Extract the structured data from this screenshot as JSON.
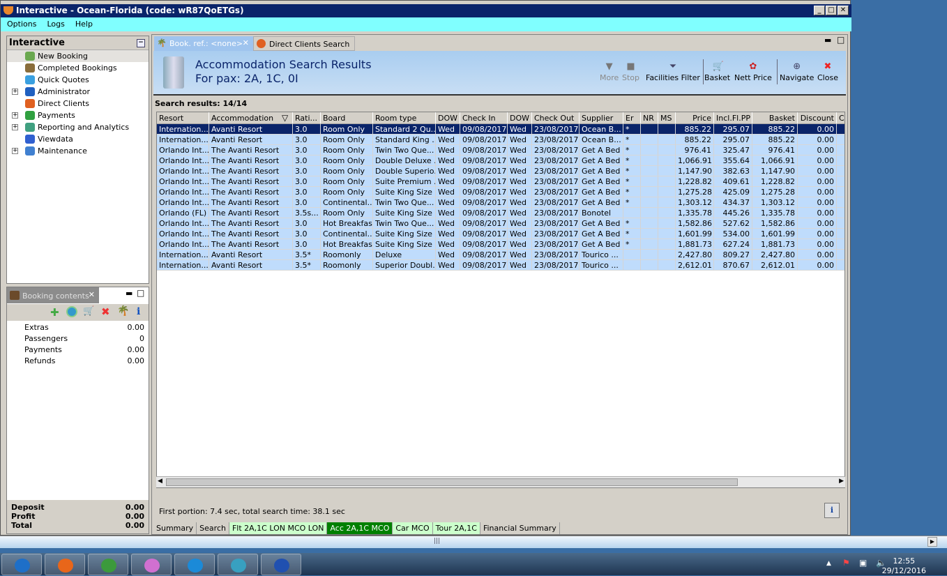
{
  "window": {
    "title": "Interactive - Ocean-Florida (code: wR87QoETGs)"
  },
  "menu": [
    "Options",
    "Logs",
    "Help"
  ],
  "nav": {
    "title": "Interactive",
    "items": [
      {
        "label": "New Booking",
        "expand": false,
        "color": "#6aa84f"
      },
      {
        "label": "Completed Bookings",
        "expand": false,
        "color": "#8a6d3b"
      },
      {
        "label": "Quick Quotes",
        "expand": false,
        "color": "#3aa0e0"
      },
      {
        "label": "Administrator",
        "expand": true,
        "color": "#2060c0"
      },
      {
        "label": "Direct Clients",
        "expand": false,
        "color": "#e06020"
      },
      {
        "label": "Payments",
        "expand": true,
        "color": "#30a040"
      },
      {
        "label": "Reporting and Analytics",
        "expand": true,
        "color": "#40a080"
      },
      {
        "label": "Viewdata",
        "expand": false,
        "color": "#3060d0"
      },
      {
        "label": "Maintenance",
        "expand": true,
        "color": "#4080d0"
      }
    ]
  },
  "booking_contents": {
    "tab": "Booking contents",
    "rows": [
      {
        "label": "Extras",
        "value": "0.00"
      },
      {
        "label": "Passengers",
        "value": "0"
      },
      {
        "label": "Payments",
        "value": "0.00"
      },
      {
        "label": "Refunds",
        "value": "0.00"
      }
    ],
    "footer": [
      {
        "label": "Deposit",
        "value": "0.00"
      },
      {
        "label": "Profit",
        "value": "0.00"
      },
      {
        "label": "Total",
        "value": "0.00"
      }
    ]
  },
  "tabs": [
    "Book. ref.: <none>",
    "Direct Clients Search"
  ],
  "header": {
    "title": "Accommodation Search Results",
    "subtitle": "For pax: 2A, 1C, 0I"
  },
  "toolbar": [
    {
      "label": "More",
      "icon": "▼",
      "disabled": true
    },
    {
      "label": "Stop",
      "icon": "■",
      "disabled": true
    },
    {
      "label": "Facilities Filter",
      "icon": "⏷"
    },
    {
      "label": "Basket",
      "icon": "🛒"
    },
    {
      "label": "Nett Price",
      "icon": "✿"
    },
    {
      "label": "Navigate",
      "icon": "⊕"
    },
    {
      "label": "Close",
      "icon": "✖"
    }
  ],
  "results_label": "Search results: 14/14",
  "table": {
    "columns": [
      "Resort",
      "Accommodation",
      "Rati...",
      "Board",
      "Room type",
      "DOW",
      "Check In",
      "DOW",
      "Check Out",
      "Supplier",
      "Er",
      "NR",
      "MS",
      "Price",
      "Incl.Fl.PP",
      "Basket",
      "Discount",
      "C"
    ],
    "rows": [
      [
        "Internation...",
        "Avanti Resort",
        "3.0",
        "Room Only",
        "Standard 2 Qu...",
        "Wed",
        "09/08/2017",
        "Wed",
        "23/08/2017",
        "Ocean B...",
        "*",
        "",
        "",
        "885.22",
        "295.07",
        "885.22",
        "0.00",
        ""
      ],
      [
        "Internation...",
        "Avanti Resort",
        "3.0",
        "Room Only",
        "Standard King ...",
        "Wed",
        "09/08/2017",
        "Wed",
        "23/08/2017",
        "Ocean B...",
        "*",
        "",
        "",
        "885.22",
        "295.07",
        "885.22",
        "0.00",
        ""
      ],
      [
        "Orlando Int...",
        "The Avanti Resort",
        "3.0",
        "Room Only",
        "Twin Two Que...",
        "Wed",
        "09/08/2017",
        "Wed",
        "23/08/2017",
        "Get A Bed",
        "*",
        "",
        "",
        "976.41",
        "325.47",
        "976.41",
        "0.00",
        ""
      ],
      [
        "Orlando Int...",
        "The Avanti Resort",
        "3.0",
        "Room Only",
        "Double Deluxe ...",
        "Wed",
        "09/08/2017",
        "Wed",
        "23/08/2017",
        "Get A Bed",
        "*",
        "",
        "",
        "1,066.91",
        "355.64",
        "1,066.91",
        "0.00",
        ""
      ],
      [
        "Orlando Int...",
        "The Avanti Resort",
        "3.0",
        "Room Only",
        "Double Superio...",
        "Wed",
        "09/08/2017",
        "Wed",
        "23/08/2017",
        "Get A Bed",
        "*",
        "",
        "",
        "1,147.90",
        "382.63",
        "1,147.90",
        "0.00",
        ""
      ],
      [
        "Orlando Int...",
        "The Avanti Resort",
        "3.0",
        "Room Only",
        "Suite Premium ...",
        "Wed",
        "09/08/2017",
        "Wed",
        "23/08/2017",
        "Get A Bed",
        "*",
        "",
        "",
        "1,228.82",
        "409.61",
        "1,228.82",
        "0.00",
        ""
      ],
      [
        "Orlando Int...",
        "The Avanti Resort",
        "3.0",
        "Room Only",
        "Suite King Size ...",
        "Wed",
        "09/08/2017",
        "Wed",
        "23/08/2017",
        "Get A Bed",
        "*",
        "",
        "",
        "1,275.28",
        "425.09",
        "1,275.28",
        "0.00",
        ""
      ],
      [
        "Orlando Int...",
        "The Avanti Resort",
        "3.0",
        "Continental...",
        "Twin Two Que...",
        "Wed",
        "09/08/2017",
        "Wed",
        "23/08/2017",
        "Get A Bed",
        "*",
        "",
        "",
        "1,303.12",
        "434.37",
        "1,303.12",
        "0.00",
        ""
      ],
      [
        "Orlando (FL)",
        "The Avanti Resort",
        "3.5s...",
        "Room Only",
        "Suite King Size ...",
        "Wed",
        "09/08/2017",
        "Wed",
        "23/08/2017",
        "Bonotel",
        "",
        "",
        "",
        "1,335.78",
        "445.26",
        "1,335.78",
        "0.00",
        ""
      ],
      [
        "Orlando Int...",
        "The Avanti Resort",
        "3.0",
        "Hot Breakfast",
        "Twin Two Que...",
        "Wed",
        "09/08/2017",
        "Wed",
        "23/08/2017",
        "Get A Bed",
        "*",
        "",
        "",
        "1,582.86",
        "527.62",
        "1,582.86",
        "0.00",
        ""
      ],
      [
        "Orlando Int...",
        "The Avanti Resort",
        "3.0",
        "Continental...",
        "Suite King Size ...",
        "Wed",
        "09/08/2017",
        "Wed",
        "23/08/2017",
        "Get A Bed",
        "*",
        "",
        "",
        "1,601.99",
        "534.00",
        "1,601.99",
        "0.00",
        ""
      ],
      [
        "Orlando Int...",
        "The Avanti Resort",
        "3.0",
        "Hot Breakfast",
        "Suite King Size ...",
        "Wed",
        "09/08/2017",
        "Wed",
        "23/08/2017",
        "Get A Bed",
        "*",
        "",
        "",
        "1,881.73",
        "627.24",
        "1,881.73",
        "0.00",
        ""
      ],
      [
        "Internation...",
        "Avanti Resort",
        "3.5*",
        "Roomonly",
        "Deluxe",
        "Wed",
        "09/08/2017",
        "Wed",
        "23/08/2017",
        "Tourico ...",
        "",
        "",
        "",
        "2,427.80",
        "809.27",
        "2,427.80",
        "0.00",
        ""
      ],
      [
        "Internation...",
        "Avanti Resort",
        "3.5*",
        "Roomonly",
        "Superior Doubl...",
        "Wed",
        "09/08/2017",
        "Wed",
        "23/08/2017",
        "Tourico ...",
        "",
        "",
        "",
        "2,612.01",
        "870.67",
        "2,612.01",
        "0.00",
        ""
      ]
    ]
  },
  "status": "First portion: 7.4 sec, total search time: 38.1 sec",
  "info_label": "i",
  "bottom_tabs": [
    {
      "label": "Summary",
      "style": ""
    },
    {
      "label": "Search",
      "style": ""
    },
    {
      "label": "Flt 2A,1C LON MCO LON",
      "style": "lg"
    },
    {
      "label": "Acc 2A,1C MCO",
      "style": "act"
    },
    {
      "label": "Car MCO",
      "style": "lg"
    },
    {
      "label": "Tour 2A,1C",
      "style": "lg"
    },
    {
      "label": "Financial Summary",
      "style": ""
    }
  ],
  "taskbar": {
    "apps": [
      {
        "name": "outlook",
        "color": "#1e6fc8"
      },
      {
        "name": "firefox",
        "color": "#e8661a"
      },
      {
        "name": "chrome",
        "color": "#3c9a3c"
      },
      {
        "name": "itunes",
        "color": "#d070d0"
      },
      {
        "name": "g-app",
        "color": "#1b8ad8"
      },
      {
        "name": "app",
        "color": "#38a0c0"
      },
      {
        "name": "remote-desktop",
        "color": "#2050b0"
      }
    ],
    "time": "12:55",
    "date": "29/12/2016"
  }
}
